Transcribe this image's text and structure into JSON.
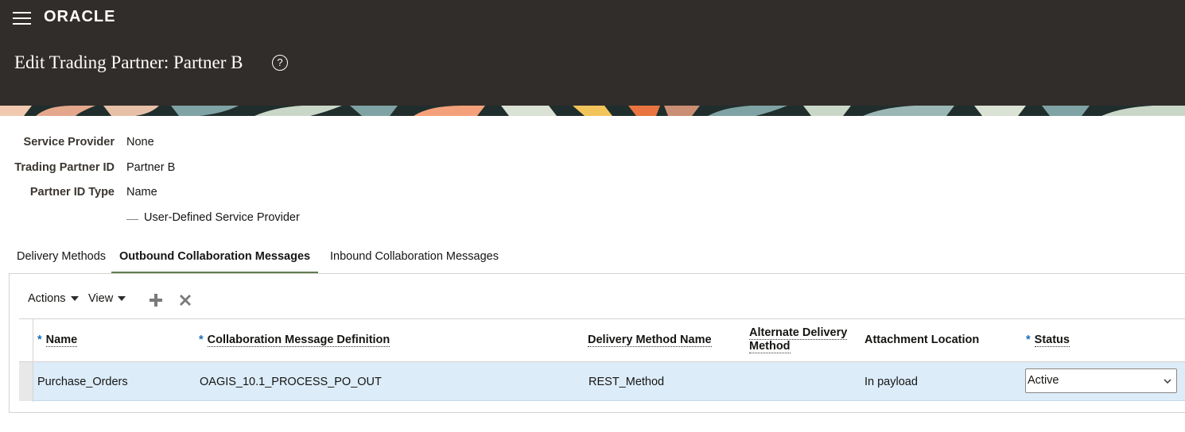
{
  "header": {
    "logo": "ORACLE",
    "page_title": "Edit Trading Partner: Partner B"
  },
  "form": [
    {
      "label": "Service Provider",
      "value": "None"
    },
    {
      "label": "Trading Partner ID",
      "value": "Partner B"
    },
    {
      "label": "Partner ID Type",
      "value": "Name"
    }
  ],
  "user_defined_label": "User-Defined Service Provider",
  "tabs": [
    {
      "label": "Delivery Methods",
      "active": false
    },
    {
      "label": "Outbound Collaboration Messages",
      "active": true
    },
    {
      "label": "Inbound Collaboration Messages",
      "active": false
    }
  ],
  "toolbar": {
    "actions_label": "Actions",
    "view_label": "View",
    "add_icon": "plus-icon",
    "delete_icon": "close-icon"
  },
  "table": {
    "columns": [
      {
        "label": "Name",
        "required": true
      },
      {
        "label": "Collaboration Message Definition",
        "required": true
      },
      {
        "label": "Delivery Method Name",
        "required": false
      },
      {
        "label": "Alternate Delivery Method",
        "required": false
      },
      {
        "label": "Attachment Location",
        "required": false
      },
      {
        "label": "Status",
        "required": true
      }
    ],
    "rows": [
      {
        "name": "Purchase_Orders",
        "definition": "OAGIS_10.1_PROCESS_PO_OUT",
        "delivery_method": "REST_Method",
        "alternate_method": "",
        "attachment_location": "In payload",
        "status": "Active"
      }
    ]
  },
  "colors": {
    "header_bg": "#312d2a",
    "active_tab_underline": "#5f7d4f",
    "selected_row": "#dcecf9",
    "required_star": "#1b6bb8"
  }
}
